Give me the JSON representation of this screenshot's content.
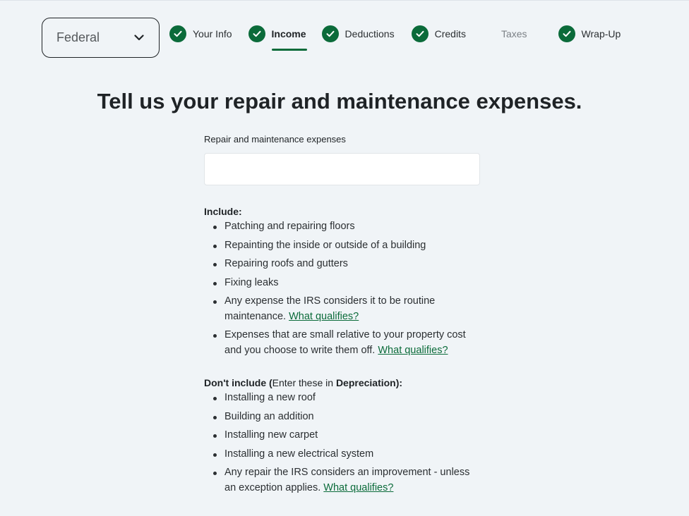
{
  "header": {
    "state_select": {
      "value": "Federal"
    },
    "steps": [
      {
        "label": "Your Info",
        "status": "complete"
      },
      {
        "label": "Income",
        "status": "active"
      },
      {
        "label": "Deductions",
        "status": "complete"
      },
      {
        "label": "Credits",
        "status": "complete"
      },
      {
        "label": "Taxes",
        "status": "pending"
      },
      {
        "label": "Wrap-Up",
        "status": "complete"
      }
    ]
  },
  "main": {
    "title": "Tell us your repair and maintenance expenses.",
    "field": {
      "label": "Repair and maintenance expenses",
      "value": "",
      "placeholder": ""
    },
    "include": {
      "heading": "Include:",
      "items": [
        "Patching and repairing floors",
        "Repainting the inside or outside of a building",
        "Repairing roofs and gutters",
        "Fixing leaks"
      ],
      "item_routine_text": "Any expense the IRS considers it to be routine maintenance.",
      "item_routine_link": "What qualifies?",
      "item_small_text": "Expenses that are small relative to your property cost and you choose to write them off.",
      "item_small_link": "What qualifies?"
    },
    "exclude": {
      "heading_bold": "Don't include (",
      "heading_normal": "Enter these in ",
      "heading_bold_2": "Depreciation",
      "heading_end": "):",
      "items": [
        "Installing a new roof",
        "Building an addition",
        "Installing new carpet",
        "Installing a new electrical system"
      ],
      "item_improvement_text": "Any repair the IRS considers an improvement - unless an exception applies.",
      "item_improvement_link": "What qualifies?"
    }
  },
  "colors": {
    "background": "#f0f4f7",
    "accent_green": "#0b6b3a",
    "text": "#1f2326",
    "muted": "#7b8086"
  },
  "icons": {
    "state_dropdown": "chevron-down-icon",
    "step_complete": "checkmark-icon"
  }
}
